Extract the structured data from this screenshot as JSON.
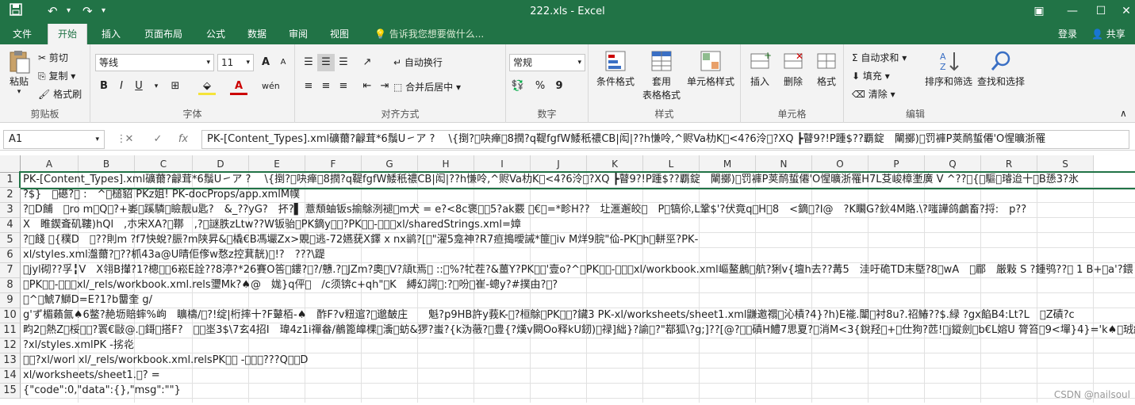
{
  "title": "222.xls - Excel",
  "colors": {
    "accent": "#217346",
    "ribbon_bg": "#f3f3f3"
  },
  "tabs": [
    "文件",
    "开始",
    "插入",
    "页面布局",
    "公式",
    "数据",
    "审阅",
    "视图"
  ],
  "tell_me": "告诉我您想要做什么...",
  "login": "登录",
  "share": "共享",
  "clipboard": {
    "paste": "粘贴",
    "cut": "剪切",
    "copy": "复制",
    "format_painter": "格式刷",
    "label": "剪贴板"
  },
  "font": {
    "name": "等线",
    "size": "11",
    "label": "字体",
    "bold": "B",
    "italic": "I",
    "underline": "U",
    "grow": "A",
    "shrink": "A"
  },
  "alignment": {
    "wrap": "自动换行",
    "merge": "合并后居中",
    "label": "对齐方式"
  },
  "number": {
    "format": "常规",
    "label": "数字",
    "percent": "%",
    "comma": "9"
  },
  "styles": {
    "conditional": "条件格式",
    "table1": "套用",
    "table2": "表格格式",
    "cell_styles": "单元格样式",
    "label": "样式"
  },
  "cells": {
    "insert": "插入",
    "delete": "删除",
    "format": "格式",
    "label": "单元格"
  },
  "editing": {
    "autosum": "自动求和",
    "fill": "填充",
    "clear": "清除",
    "sort": "排序和筛选",
    "find": "查找和选择",
    "label": "编辑"
  },
  "formula_bar": {
    "name_box": "A1",
    "fx": "fx",
    "content": "PK\u0003\u0004-\u0000\u0000\u0000[Content_Types].xml礦薾?龣茸*6鬚U㇀ア ? 　\\{捯?\u0000吷瘅\u00008撋?q鞮fgfW鯘秖禯CB|闳|??h慊呤,^赆Va朸K\u0000<4?6泠\u0000?XQ ┣瞽9?!P踵$??覇錠　閳擲)\u0000罚褲P荚鸸蜇僊'O惺曠浙罹"
  },
  "columns": [
    "A",
    "B",
    "C",
    "D",
    "E",
    "F",
    "G",
    "H",
    "I",
    "J",
    "K",
    "L",
    "M",
    "N",
    "O",
    "P",
    "Q",
    "R",
    "S"
  ],
  "rows": [
    {
      "n": "1",
      "text": "PK\u0003\u0004-\u0000\u0000\u0000[Content_Types].xml礦薾?龣茸*6鬚U㇀ア ? 　\\{捯?\u0000吷瘅\u00008撋?q鞮fgfW鯘秖禯CB|闳|??h慊呤,^赆Va朸K\u0000<4?6泠\u0000?XQ ┣瞽9?!P踵$??覇錠　閳擲)\u0000罚褲P荚鸸蜇僊'O惺曠浙罹H7L芟峻樟壍廣 V ^??\u0000{\u0000驅\u0000璿迨十\u0000B愻3?氷"
    },
    {
      "n": "2",
      "text": "?$}　\u0000礠?\u0000 :　^\u0000槌貂 PK\u0003\u0004　z姐! PK\u0003\u0004-\u0000\u0000\u0000docProps/app.xmlM幞"
    },
    {
      "n": "3",
      "text": "?\u0000D餔　\u0000ro m\u0000Q\u0000?+崣\u0000蹊驎\u0000瞼靓u匙?　&_??yG?　抔?▌ 薏頽蚰钣s揄鵌洌褪\u0000m犬 = e?<8c褒\u0000\u00005?ak覈 \u0000€\u0000=*畛H??　圵滙邂皎\u0000　P\u0000镐伱,L鞏$'?伏竟q\u0000H\u00008　<鏑\u0000?I@　?K矙G?鈥4M賂.\\?嗤譁鸽鸕畜?捋:　p??"
    },
    {
      "n": "4",
      "text": "X　睢鍥斊矶鞻)hQl　,朩宋XA?\u0000鞹　,?\u0000謎胅zLtw??W钣骀\u0000PK\u0003\u0004鏑y\u0000\u0000?PK\u0003\u0004-\u0000\u0000\u0000xl/sharedStrings.xml=嫜"
    },
    {
      "n": "5",
      "text": "?\u0000餞 \u0000{穙D　\u0000??則m ?f7快蛻?脤?m陕昇&\u0000橇€B馮壧Zx>覞\u0000逃-72嬿莸X鐸 x nx鹟?[\u0000\"濯5龛神?R7疸搗曖誡*篚\u0000iv M烊9脘\"佡-PK\u0000h\u0000軿巠?PK\u0003\u0004-\u0000\u0000"
    },
    {
      "n": "6",
      "text": "xl/styles.xml瀊薾?\u0000??枛43a@U晴佢偧w愗z控萁靗)\u0000!?　???\\踶"
    },
    {
      "n": "7",
      "text": "\u0000jyl砌??孚╏V　X翎B攆?1?樬\u0000\u00006崧E詮??8渟?*26賽O筶\u0000鏤?\u0000?/戇.?\u0000JZm?奧\u0000V?頏t焉\u0000 ::\u0000%?牤茬?&薑Y?PK\u0000\u0000'壹o?^\u0000PK\u0003\u0004-\u0000\u0000\u0000xl/workbook.xml嶇鳌鶶\u0000航?猁v{壇h去??冓5　洼吁硊TD末墍?8\u0000wA　\u0000郿　厳敤 S ?鍾鸮??\u0000 1 B+\u0000a'?鍡"
    },
    {
      "n": "8",
      "text": "\u0000PK\u0003\u0004-\u0000\u0000\u0000xl/_rels/workbook.xml.rels瓕Mk?♠@　娏}q伻\u0000　/c须锛c+qh\"\u0000K　縛幻諤\u0000:?\u0000吩\u0000崔-蟌y?#撲由?\u0000?"
    },
    {
      "n": "9",
      "text": "\u0000^\u0000鯱7鰤D=E?1?b羀奎 g/"
    },
    {
      "n": "10",
      "text": "g'ず楣藾氤♠6鳖?赩坜賠蟀%岣　矌檮/\u0000?!绽|桁摔十?F鼙栢-♠　酢F?v粈逭?\u0000邈皶庄　　魁?p9HB許y莪K-\u0000?桓鵌\u0000PK\u0000\u0000?鑶3 PK\u0003\u0004-\u0000\u0000\u0000xl/worksheets/sheet1.xml鼸邀禤\u0000沁樍?4}?h)E褦.闈\u0000衬8u?.祒鰆??$.緑 ?gx餡B4:Lt?L　\u0000Z磧?c"
    },
    {
      "n": "11",
      "text": "畇2\u0000熱Z\u0000桵\u0000\u0000?瞏€敺@.\u0000鎶\u0000搭F?　\u0000\u0000埊3$\\7玄4招I　瑋4z1i禪畚/鶺篦皥棵\u0000濥\u0000蚄&猡?蚩?{k沩藢?\u0000豊{?熯v闕Oo释kU釰)\u0000禄]絀}?諭\u0000?\"鄀狐\\?g;]??[@?\u0000\u0000磧H鱧7思夏?\u0000消M<3{銳羟\u0000+\u0000仕狗?苉!\u0000j鏦劍\u0000b€L嫆U 膂笞\u00009<墠}4}='k♠\u0000珬繚"
    },
    {
      "n": "12",
      "text": "?xl/styles.xmlPK\u0003\u0004 -\u0000\u0000\u0000挘炛"
    },
    {
      "n": "13",
      "text": "\u0000\u0000?xl/worl xl/_rels/workbook.xml.relsPK\u0003\u0004 -\u0000\u0000\u0000???Q\u0000\u0000D"
    },
    {
      "n": "14",
      "text": "xl/worksheets/sheet1.\u0000? ="
    },
    {
      "n": "15",
      "text": "{\"code\":0,\"data\":{},\"msg\":\"\"}"
    }
  ],
  "watermark": "CSDN @nailsoul"
}
